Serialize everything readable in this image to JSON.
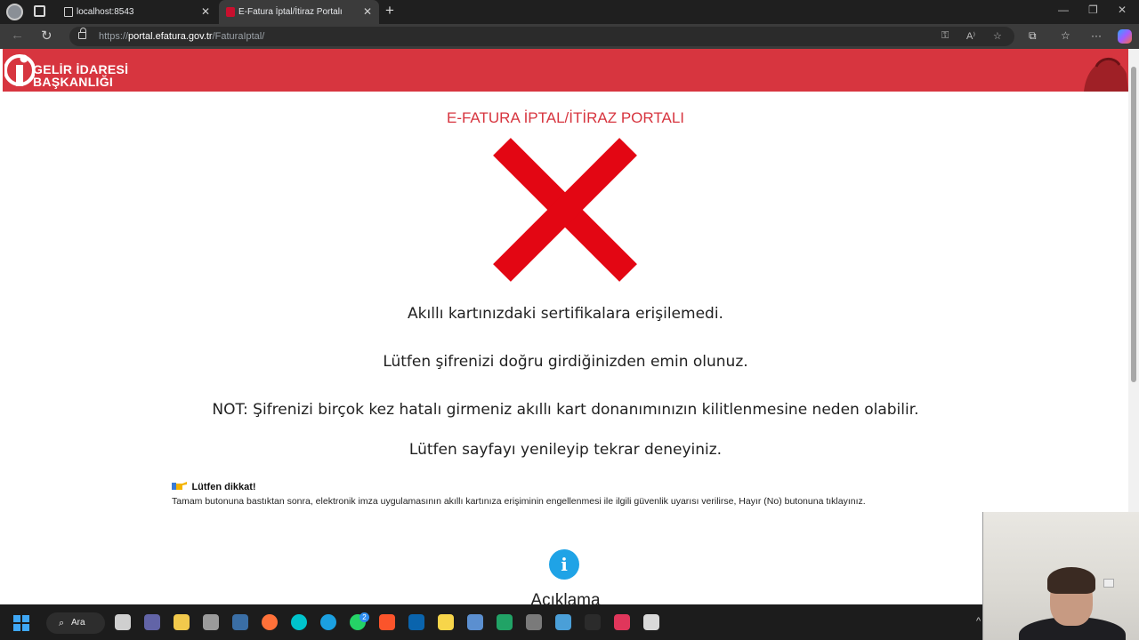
{
  "browser": {
    "tabs": [
      {
        "title": "localhost:8543",
        "active": false
      },
      {
        "title": "E-Fatura İptal/İtiraz Portalı",
        "active": true
      }
    ],
    "url_scheme": "https://",
    "url_host": "portal.efatura.gov.tr",
    "url_path": "/FaturaIptal/"
  },
  "header": {
    "logo_line1": "GELİR İDARESİ",
    "logo_line2": "BAŞKANLIĞI"
  },
  "page": {
    "title": "E-FATURA İPTAL/İTİRAZ PORTALI",
    "error_icon": "red-x-icon",
    "messages": [
      "Akıllı kartınızdaki sertifikalara erişilemedi.",
      "Lütfen şifrenizi doğru girdiğinizden emin olunuz.",
      "NOT: Şifrenizi birçok kez hatalı girmeniz akıllı kart donanımınızın kilitlenmesine neden olabilir.",
      "Lütfen sayfayı yenileyip tekrar deneyiniz."
    ],
    "warning_title": "Lütfen dikkat!",
    "warning_text": "Tamam butonuna bastıktan sonra, elektronik imza uygulamasının akıllı kartınıza erişiminin engellenmesi ile ilgili güvenlik uyarısı verilirse, Hayır (No) butonuna tıklayınız.",
    "info_heading": "Açıklama"
  },
  "taskbar": {
    "search_label": "Ara",
    "whatsapp_badge": "2"
  },
  "colors": {
    "brand_red": "#d7353f",
    "error_red": "#e30613",
    "info_blue": "#1fa3e6"
  }
}
